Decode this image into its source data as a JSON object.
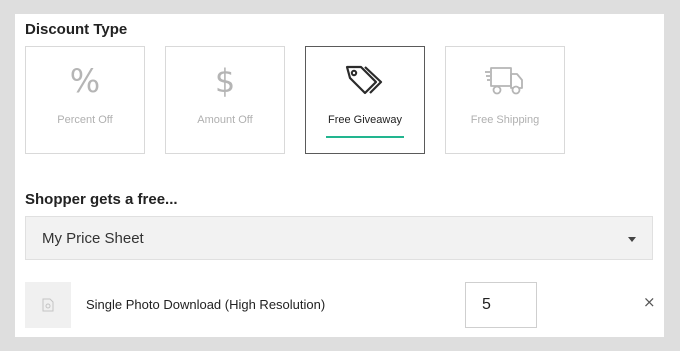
{
  "discount": {
    "title": "Discount Type",
    "options": [
      {
        "label": "Percent Off",
        "icon": "percent-icon",
        "symbol": "%",
        "selected": false
      },
      {
        "label": "Amount Off",
        "icon": "dollar-icon",
        "symbol": "$",
        "selected": false
      },
      {
        "label": "Free Giveaway",
        "icon": "tags-icon",
        "selected": true
      },
      {
        "label": "Free Shipping",
        "icon": "truck-icon",
        "selected": false
      }
    ]
  },
  "shopper": {
    "title": "Shopper gets a free...",
    "select_value": "My Price Sheet"
  },
  "item": {
    "name": "Single Photo Download (High Resolution)",
    "quantity": "5",
    "thumb_icon": "photo-file-icon",
    "remove_icon": "close-icon",
    "remove_symbol": "×"
  },
  "colors": {
    "accent": "#22b58f",
    "selected_border": "#5a5a5a",
    "muted_text": "#b0b0b0"
  }
}
